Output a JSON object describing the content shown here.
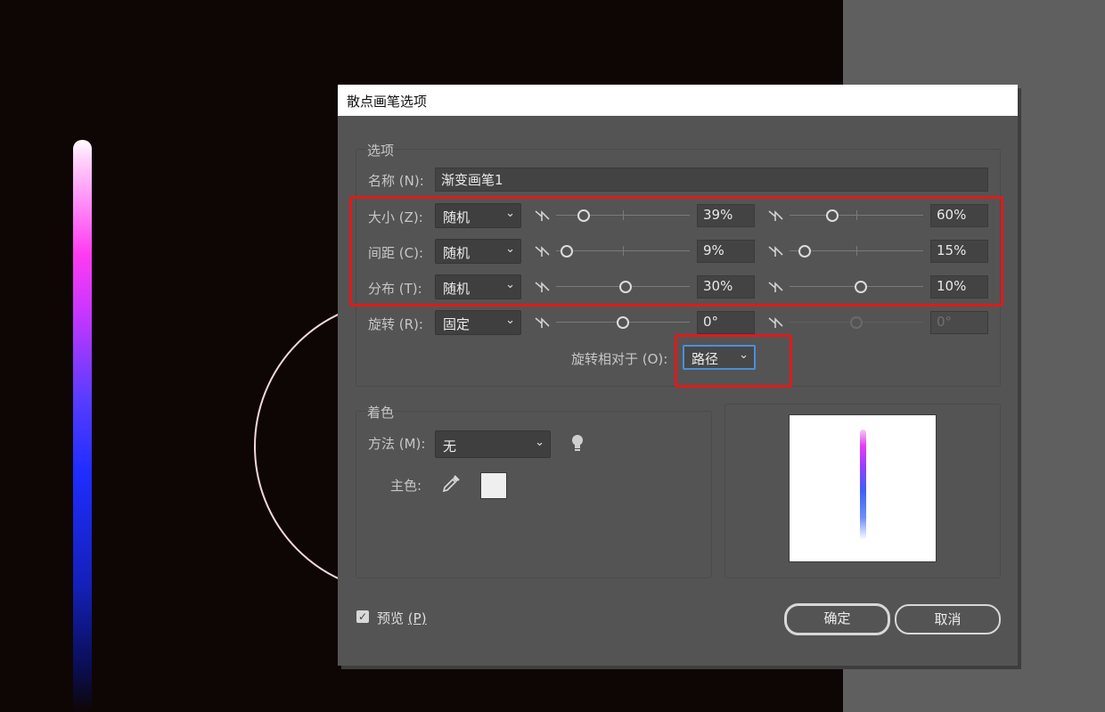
{
  "dialog": {
    "title": "散点画笔选项",
    "options_legend": "选项",
    "name_label": "名称 (N):",
    "name_value": "渐变画笔1",
    "size": {
      "label": "大小 (Z):",
      "mode": "随机",
      "min_value": "39%",
      "max_value": "60%",
      "min_pos": 0.18,
      "max_pos": 0.3
    },
    "spacing": {
      "label": "间距 (C):",
      "mode": "随机",
      "min_value": "9%",
      "max_value": "15%",
      "min_pos": 0.04,
      "max_pos": 0.07
    },
    "scatter": {
      "label": "分布 (T):",
      "mode": "随机",
      "min_value": "30%",
      "max_value": "10%",
      "min_pos": 0.52,
      "max_pos": 0.54
    },
    "rotation": {
      "label": "旋转 (R):",
      "mode": "固定",
      "min_value": "0°",
      "max_value": "0°",
      "min_pos": 0.5,
      "max_pos": 0.5
    },
    "rotation_relative": {
      "label": "旋转相对于 (O):",
      "value": "路径"
    },
    "colorization": {
      "legend": "着色",
      "method_label": "方法 (M):",
      "method_value": "无",
      "key_color_label": "主色:",
      "key_color": "#efefef"
    },
    "preview_label": "预览",
    "preview_accel": "(P)",
    "preview_checked": true,
    "ok_label": "确定",
    "cancel_label": "取消"
  },
  "colors": {
    "highlight": "#e01a1a",
    "dialog_bg": "#545454",
    "canvas_bg": "#0e0605",
    "workspace_bg": "#5f5f5f"
  },
  "icons": [
    "pressure-icon",
    "tips-lightbulb-icon",
    "eyedropper-icon",
    "checkmark-icon",
    "chevron-down-icon"
  ]
}
